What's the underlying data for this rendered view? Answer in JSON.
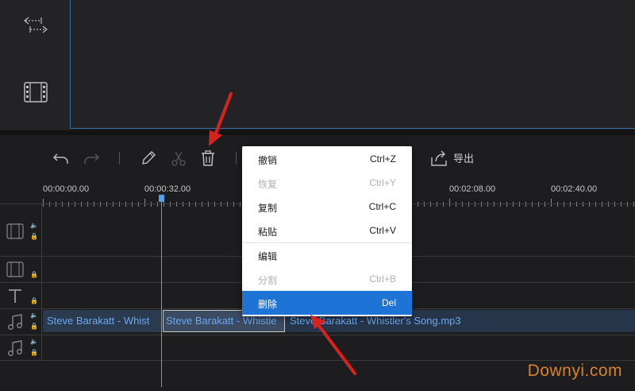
{
  "toolbar": {
    "export_label": "导出"
  },
  "ruler": {
    "ticks": [
      "00:00:00.00",
      "00:00:32.00",
      "00:02:08.00",
      "00:02:40.00"
    ]
  },
  "clips": {
    "clip1": "Steve Barakatt - Whist",
    "clip2": "Steve Barakatt - Whistle",
    "clip3": "Steve Barakatt - Whistler's Song.mp3"
  },
  "context_menu": {
    "items": [
      {
        "label": "撤销",
        "shortcut": "Ctrl+Z",
        "state": "normal"
      },
      {
        "label": "恢复",
        "shortcut": "Ctrl+Y",
        "state": "disabled"
      },
      {
        "label": "复制",
        "shortcut": "Ctrl+C",
        "state": "normal"
      },
      {
        "label": "粘贴",
        "shortcut": "Ctrl+V",
        "state": "normal"
      },
      {
        "label": "编辑",
        "shortcut": "",
        "state": "normal"
      },
      {
        "label": "分割",
        "shortcut": "Ctrl+B",
        "state": "disabled"
      },
      {
        "label": "删除",
        "shortcut": "Del",
        "state": "active"
      }
    ]
  },
  "watermark": "Downyi.com",
  "colors": {
    "accent": "#1e73d6",
    "clip_text": "#6aa8ef",
    "playhead": "#5aa0e6",
    "arrow": "#d8221e",
    "watermark": "#d9822b"
  }
}
